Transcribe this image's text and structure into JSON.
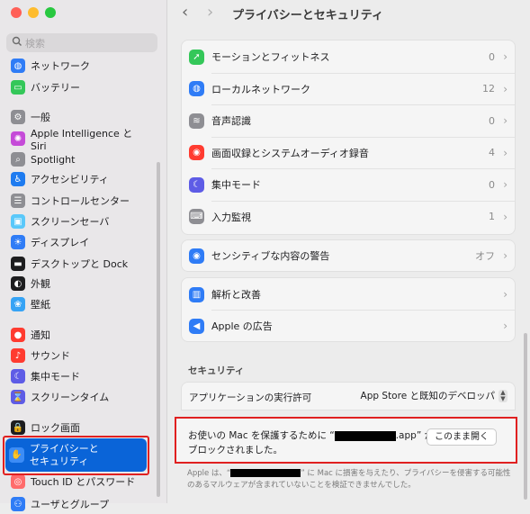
{
  "sidebar": {
    "search_placeholder": "検索",
    "items": [
      {
        "label": "ネットワーク",
        "icon": "globe-icon",
        "color": "#2f7cf6"
      },
      {
        "label": "バッテリー",
        "icon": "battery-icon",
        "color": "#34c759"
      },
      {
        "label": "一般",
        "icon": "gear-icon",
        "color": "#8e8e93"
      },
      {
        "label": "Apple Intelligence と Siri",
        "icon": "siri-icon",
        "color": "#c54bd8"
      },
      {
        "label": "Spotlight",
        "icon": "magnifier-icon",
        "color": "#8e8e93"
      },
      {
        "label": "アクセシビリティ",
        "icon": "accessibility-icon",
        "color": "#1e7bf0"
      },
      {
        "label": "コントロールセンター",
        "icon": "control-center-icon",
        "color": "#8e8e93"
      },
      {
        "label": "スクリーンセーバ",
        "icon": "screensaver-icon",
        "color": "#5ac8fa"
      },
      {
        "label": "ディスプレイ",
        "icon": "display-icon",
        "color": "#2f7cf6"
      },
      {
        "label": "デスクトップと Dock",
        "icon": "dock-icon",
        "color": "#1d1d1f"
      },
      {
        "label": "外観",
        "icon": "appearance-icon",
        "color": "#1d1d1f"
      },
      {
        "label": "壁紙",
        "icon": "wallpaper-icon",
        "color": "#36a3f5"
      },
      {
        "label": "通知",
        "icon": "notification-icon",
        "color": "#ff3b30"
      },
      {
        "label": "サウンド",
        "icon": "speaker-icon",
        "color": "#ff3b30"
      },
      {
        "label": "集中モード",
        "icon": "moon-icon",
        "color": "#5e5ce6"
      },
      {
        "label": "スクリーンタイム",
        "icon": "hourglass-icon",
        "color": "#5e5ce6"
      },
      {
        "label": "ロック画面",
        "icon": "lock-icon",
        "color": "#1d1d1f"
      },
      {
        "label": "Touch ID とパスワード",
        "icon": "fingerprint-icon",
        "color": "#ff6b6b"
      },
      {
        "label": "ユーザとグループ",
        "icon": "users-icon",
        "color": "#2f7cf6"
      }
    ],
    "selected": {
      "line1": "プライバシーと",
      "line2": "セキュリティ",
      "icon": "hand-icon"
    }
  },
  "header": {
    "title": "プライバシーとセキュリティ",
    "back": "‹",
    "forward": "›"
  },
  "privacy_rows": [
    {
      "label": "モーションとフィットネス",
      "value": "0",
      "color": "#34c759",
      "icon": "running-icon"
    },
    {
      "label": "ローカルネットワーク",
      "value": "12",
      "color": "#2f7cf6",
      "icon": "globe-icon"
    },
    {
      "label": "音声認識",
      "value": "0",
      "color": "#8e8e93",
      "icon": "waveform-icon"
    },
    {
      "label": "画面収録とシステムオーディオ録音",
      "value": "4",
      "color": "#ff3b30",
      "icon": "record-icon"
    },
    {
      "label": "集中モード",
      "value": "0",
      "color": "#5e5ce6",
      "icon": "moon-icon"
    },
    {
      "label": "入力監視",
      "value": "1",
      "color": "#8e8e93",
      "icon": "keyboard-icon"
    }
  ],
  "sensitive": {
    "label": "センシティブな内容の警告",
    "value": "オフ",
    "color": "#2f7cf6",
    "icon": "eye-icon"
  },
  "analytics": [
    {
      "label": "解析と改善",
      "color": "#2f7cf6",
      "icon": "chart-icon"
    },
    {
      "label": "Apple の広告",
      "color": "#2f7cf6",
      "icon": "megaphone-icon"
    }
  ],
  "security": {
    "title": "セキュリティ",
    "exec_label": "アプリケーションの実行許可",
    "exec_value": "App Store と既知のデベロッパ",
    "block_line1_a": "お使いの Mac を保護するために “",
    "block_line1_b": ".app” が",
    "block_line2": "ブロックされました。",
    "open_button": "このまま開く",
    "note_a": "Apple は、“",
    "note_b": "” に Mac に損害を与えたり、プライバシーを侵害する可能性",
    "note_c": "のあるマルウェアが含まれていないことを検証できませんでした。"
  }
}
